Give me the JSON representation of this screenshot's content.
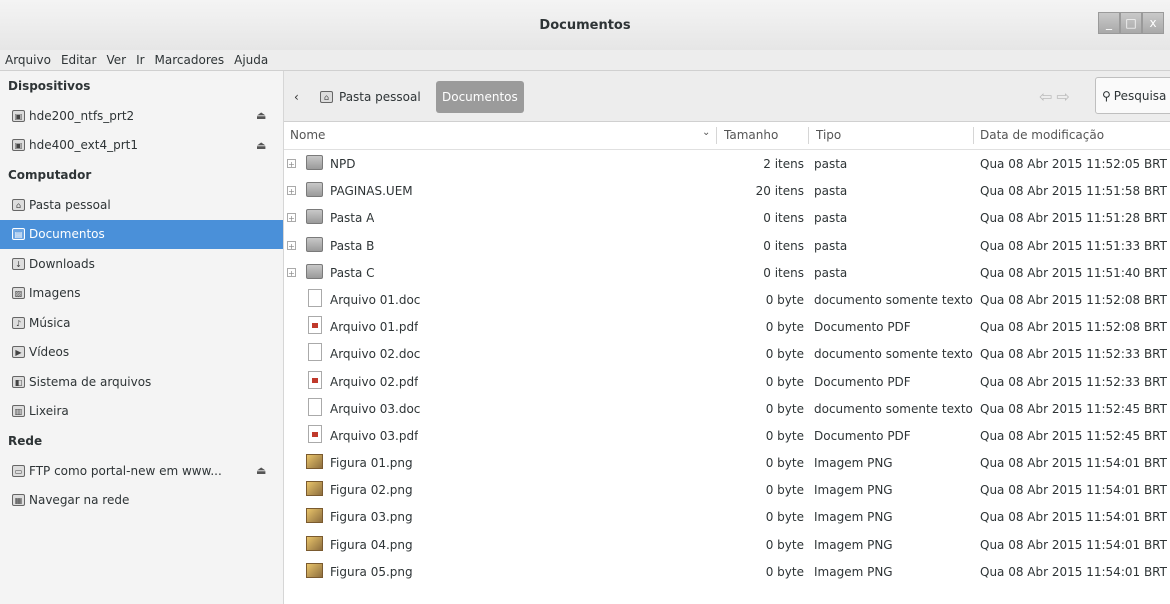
{
  "window": {
    "title": "Documentos",
    "buttons": [
      "_",
      "□",
      "x"
    ]
  },
  "menubar": [
    "Arquivo",
    "Editar",
    "Ver",
    "Ir",
    "Marcadores",
    "Ajuda"
  ],
  "sidebar": {
    "sections": [
      {
        "title": "Dispositivos",
        "items": [
          {
            "label": "hde200_ntfs_prt2",
            "icon": "drive-icon",
            "eject": true
          },
          {
            "label": "hde400_ext4_prt1",
            "icon": "drive-icon",
            "eject": true
          }
        ]
      },
      {
        "title": "Computador",
        "items": [
          {
            "label": "Pasta pessoal",
            "icon": "home-folder-icon"
          },
          {
            "label": "Documentos",
            "icon": "documents-folder-icon",
            "active": true
          },
          {
            "label": "Downloads",
            "icon": "downloads-folder-icon"
          },
          {
            "label": "Imagens",
            "icon": "pictures-folder-icon"
          },
          {
            "label": "Música",
            "icon": "music-folder-icon"
          },
          {
            "label": "Vídeos",
            "icon": "videos-folder-icon"
          },
          {
            "label": "Sistema de arquivos",
            "icon": "filesystem-icon"
          },
          {
            "label": "Lixeira",
            "icon": "trash-icon"
          }
        ]
      },
      {
        "title": "Rede",
        "items": [
          {
            "label": "FTP como portal-new em www...",
            "icon": "network-share-icon",
            "eject": true
          },
          {
            "label": "Navegar na rede",
            "icon": "network-icon"
          }
        ]
      }
    ]
  },
  "pathbar": {
    "back": "‹",
    "home_label": "Pasta pessoal",
    "current_label": "Documentos",
    "search_label": "Pesquisa"
  },
  "columns": {
    "name": "Nome",
    "size": "Tamanho",
    "type": "Tipo",
    "date": "Data de modificação"
  },
  "files": [
    {
      "name": "NPD",
      "size": "2 itens",
      "type": "pasta",
      "date": "Qua 08 Abr 2015 11:52:05 BRT",
      "kind": "folder"
    },
    {
      "name": "PAGINAS.UEM",
      "size": "20 itens",
      "type": "pasta",
      "date": "Qua 08 Abr 2015 11:51:58 BRT",
      "kind": "folder"
    },
    {
      "name": "Pasta A",
      "size": "0 itens",
      "type": "pasta",
      "date": "Qua 08 Abr 2015 11:51:28 BRT",
      "kind": "folder"
    },
    {
      "name": "Pasta B",
      "size": "0 itens",
      "type": "pasta",
      "date": "Qua 08 Abr 2015 11:51:33 BRT",
      "kind": "folder"
    },
    {
      "name": "Pasta C",
      "size": "0 itens",
      "type": "pasta",
      "date": "Qua 08 Abr 2015 11:51:40 BRT",
      "kind": "folder"
    },
    {
      "name": "Arquivo 01.doc",
      "size": "0 byte",
      "type": "documento somente texto",
      "date": "Qua 08 Abr 2015 11:52:08 BRT",
      "kind": "doc"
    },
    {
      "name": "Arquivo 01.pdf",
      "size": "0 byte",
      "type": "Documento PDF",
      "date": "Qua 08 Abr 2015 11:52:08 BRT",
      "kind": "pdf"
    },
    {
      "name": "Arquivo 02.doc",
      "size": "0 byte",
      "type": "documento somente texto",
      "date": "Qua 08 Abr 2015 11:52:33 BRT",
      "kind": "doc"
    },
    {
      "name": "Arquivo 02.pdf",
      "size": "0 byte",
      "type": "Documento PDF",
      "date": "Qua 08 Abr 2015 11:52:33 BRT",
      "kind": "pdf"
    },
    {
      "name": "Arquivo 03.doc",
      "size": "0 byte",
      "type": "documento somente texto",
      "date": "Qua 08 Abr 2015 11:52:45 BRT",
      "kind": "doc"
    },
    {
      "name": "Arquivo 03.pdf",
      "size": "0 byte",
      "type": "Documento PDF",
      "date": "Qua 08 Abr 2015 11:52:45 BRT",
      "kind": "pdf"
    },
    {
      "name": "Figura 01.png",
      "size": "0 byte",
      "type": "Imagem PNG",
      "date": "Qua 08 Abr 2015 11:54:01 BRT",
      "kind": "png"
    },
    {
      "name": "Figura 02.png",
      "size": "0 byte",
      "type": "Imagem PNG",
      "date": "Qua 08 Abr 2015 11:54:01 BRT",
      "kind": "png"
    },
    {
      "name": "Figura 03.png",
      "size": "0 byte",
      "type": "Imagem PNG",
      "date": "Qua 08 Abr 2015 11:54:01 BRT",
      "kind": "png"
    },
    {
      "name": "Figura 04.png",
      "size": "0 byte",
      "type": "Imagem PNG",
      "date": "Qua 08 Abr 2015 11:54:01 BRT",
      "kind": "png"
    },
    {
      "name": "Figura 05.png",
      "size": "0 byte",
      "type": "Imagem PNG",
      "date": "Qua 08 Abr 2015 11:54:01 BRT",
      "kind": "png"
    }
  ],
  "colors": {
    "accent": "#4a90d9",
    "crumb_active": "#9b9b9b"
  }
}
